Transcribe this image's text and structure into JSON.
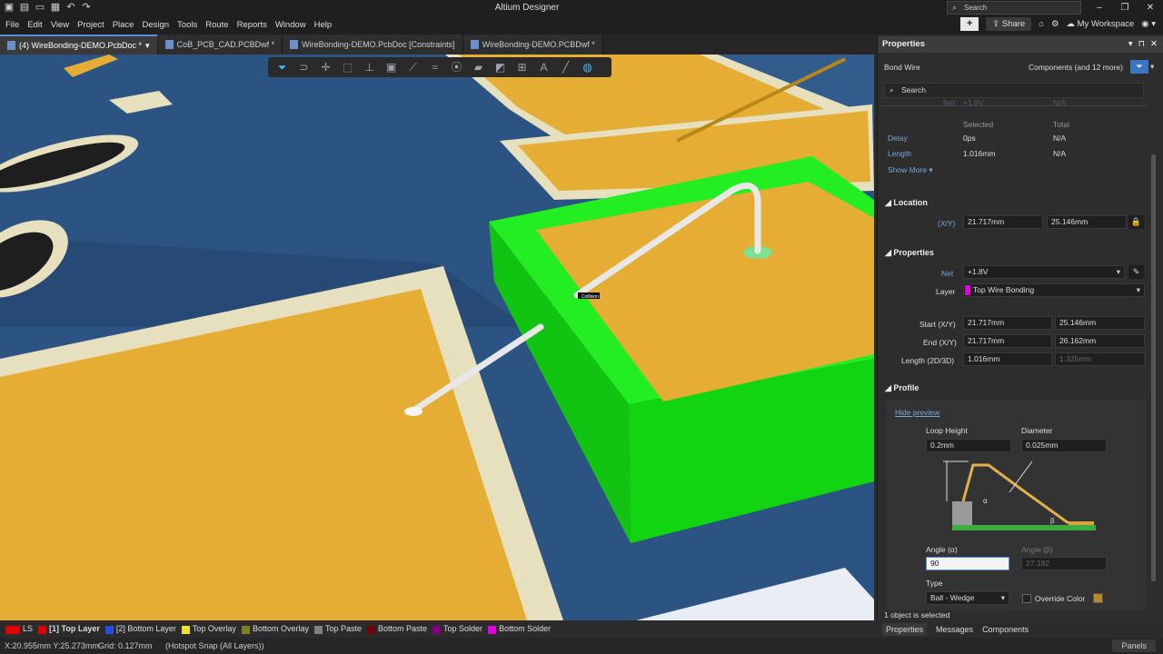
{
  "app": {
    "title": "Altium Designer",
    "search_placeholder": "Search",
    "share": "Share",
    "workspace": "My Workspace"
  },
  "menu": [
    "File",
    "Edit",
    "View",
    "Project",
    "Place",
    "Design",
    "Tools",
    "Route",
    "Reports",
    "Window",
    "Help"
  ],
  "tabs": [
    {
      "label": "(4) WireBonding-DEMO.PcbDoc *",
      "active": true
    },
    {
      "label": "CoB_PCB_CAD.PCBDwf *"
    },
    {
      "label": "WireBonding-DEMO.PcbDoc [Constraints]"
    },
    {
      "label": "WireBonding-DEMO.PCBDwf *"
    }
  ],
  "canvas": {
    "collision_label": "Collision"
  },
  "layers": [
    {
      "name": "LS",
      "color": "#e00000"
    },
    {
      "name": "[1] Top Layer",
      "color": "#e00000",
      "active": true
    },
    {
      "name": "[2] Bottom Layer",
      "color": "#2050e0"
    },
    {
      "name": "Top Overlay",
      "color": "#f0e030"
    },
    {
      "name": "Bottom Overlay",
      "color": "#808020"
    },
    {
      "name": "Top Paste",
      "color": "#808080"
    },
    {
      "name": "Bottom Paste",
      "color": "#700010"
    },
    {
      "name": "Top Solder",
      "color": "#800080"
    },
    {
      "name": "Bottom Solder",
      "color": "#e000e0"
    }
  ],
  "status": {
    "coords": "X:20.955mm Y:25.273mm",
    "grid": "Grid: 0.127mm",
    "snap": "(Hotspot Snap (All Layers))",
    "panels": "Panels"
  },
  "panel": {
    "title": "Properties",
    "object_type": "Bond Wire",
    "filter_text": "Components (and 12 more)",
    "search_placeholder": "Search",
    "net_partial": "Net",
    "net_partial_val": "+1.8V",
    "net_partial_total": "N/A",
    "col_selected": "Selected",
    "col_total": "Total",
    "delay_label": "Delay",
    "delay_sel": "0ps",
    "delay_total": "N/A",
    "length_label": "Length",
    "length_sel": "1.016mm",
    "length_total": "N/A",
    "show_more": "Show More ▾",
    "location_title": "Location",
    "xy_label": "(X/Y)",
    "loc_x": "21.717mm",
    "loc_y": "25.146mm",
    "properties_title": "Properties",
    "net_label": "Net",
    "net_value": "+1.8V",
    "layer_label": "Layer",
    "layer_value": "Top Wire Bonding",
    "layer_color": "#e000e0",
    "start_label": "Start (X/Y)",
    "start_x": "21.717mm",
    "start_y": "25.146mm",
    "end_label": "End (X/Y)",
    "end_x": "21.717mm",
    "end_y": "26.162mm",
    "len_label": "Length (2D/3D)",
    "len_2d": "1.016mm",
    "len_3d": "1.325mm",
    "profile_title": "Profile",
    "hide_preview": "Hide preview",
    "loop_height_label": "Loop Height",
    "loop_height": "0.2mm",
    "diameter_label": "Diameter",
    "diameter": "0.025mm",
    "alpha_mark": "α",
    "beta_mark": "β",
    "angle_a_label": "Angle (α)",
    "angle_a": "90",
    "angle_b_label": "Angle (β)",
    "angle_b": "27.182",
    "type_label": "Type",
    "type_value": "Ball - Wedge",
    "override_color": "Override Color",
    "selected_count": "1 object is selected"
  },
  "panel_tabs": [
    "Properties",
    "Messages",
    "Components"
  ]
}
